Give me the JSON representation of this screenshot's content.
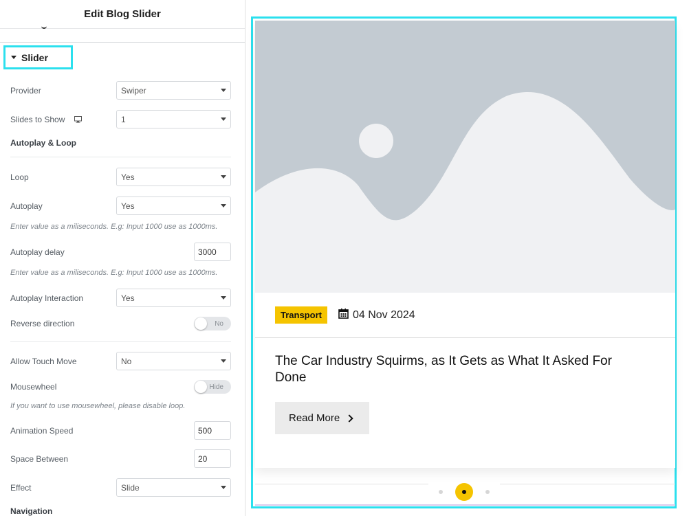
{
  "panel": {
    "title": "Edit Blog Slider",
    "section_title": "Slider",
    "provider": {
      "label": "Provider",
      "value": "Swiper"
    },
    "slides_to_show": {
      "label": "Slides to Show",
      "value": "1"
    },
    "autoplay_loop_heading": "Autoplay & Loop",
    "loop": {
      "label": "Loop",
      "value": "Yes"
    },
    "autoplay": {
      "label": "Autoplay",
      "value": "Yes"
    },
    "autoplay_hint": "Enter value as a miliseconds. E.g: Input 1000 use as 1000ms.",
    "autoplay_delay": {
      "label": "Autoplay delay",
      "value": "3000"
    },
    "autoplay_delay_hint": "Enter value as a miliseconds. E.g: Input 1000 use as 1000ms.",
    "autoplay_interaction": {
      "label": "Autoplay Interaction",
      "value": "Yes"
    },
    "reverse_direction": {
      "label": "Reverse direction",
      "state": "No"
    },
    "allow_touch_move": {
      "label": "Allow Touch Move",
      "value": "No"
    },
    "mousewheel": {
      "label": "Mousewheel",
      "state": "Hide"
    },
    "mousewheel_hint": "If you want to use mousewheel, please disable loop.",
    "animation_speed": {
      "label": "Animation Speed",
      "value": "500"
    },
    "space_between": {
      "label": "Space Between",
      "value": "20"
    },
    "effect": {
      "label": "Effect",
      "value": "Slide"
    },
    "navigation_heading": "Navigation"
  },
  "preview": {
    "badge": "Transport",
    "date": "04 Nov 2024",
    "post_title": "The Car Industry Squirms, as It Gets as What It Asked For Done",
    "read_more": "Read More"
  },
  "colors": {
    "highlight": "#2be0ee",
    "accent": "#f5c400",
    "placeholder_bg": "#c3cbd2",
    "placeholder_fg": "#f0f1f3"
  }
}
